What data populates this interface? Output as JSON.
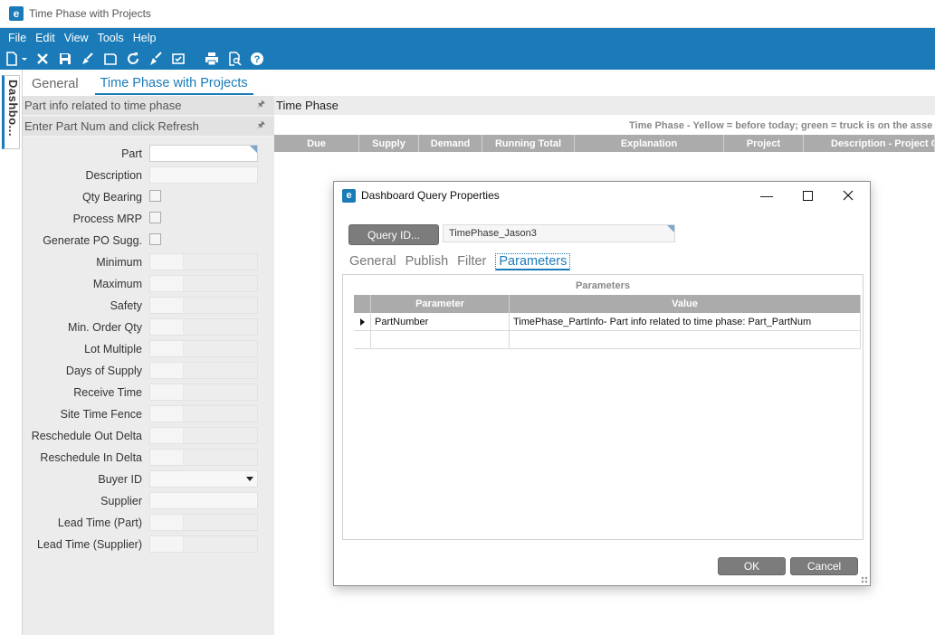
{
  "window": {
    "title": "Time Phase with Projects",
    "logo": "e"
  },
  "menu": [
    "File",
    "Edit",
    "View",
    "Tools",
    "Help"
  ],
  "toolbar_icons": [
    "new-icon",
    "dropdown-arrow-icon",
    "delete-icon",
    "save-icon",
    "clear-icon",
    "new-page-icon",
    "refresh-icon",
    "clear-broom-icon",
    "approve-icon",
    "print-icon",
    "print-preview-icon",
    "help-icon"
  ],
  "side_tab": {
    "label": "Dashbo..."
  },
  "tabs": [
    {
      "label": "General",
      "active": false
    },
    {
      "label": "Time Phase with Projects",
      "active": true
    }
  ],
  "left_panel": {
    "headers": [
      "Part info related to time phase",
      "Enter Part Num and click Refresh"
    ],
    "fields": [
      {
        "label": "Part",
        "type": "text"
      },
      {
        "label": "Description",
        "type": "text"
      },
      {
        "label": "Qty Bearing",
        "type": "checkbox"
      },
      {
        "label": "Process MRP",
        "type": "checkbox"
      },
      {
        "label": "Generate PO Sugg.",
        "type": "checkbox"
      },
      {
        "label": "Minimum",
        "type": "number"
      },
      {
        "label": "Maximum",
        "type": "number"
      },
      {
        "label": "Safety",
        "type": "number"
      },
      {
        "label": "Min. Order Qty",
        "type": "number"
      },
      {
        "label": "Lot Multiple",
        "type": "number"
      },
      {
        "label": "Days of Supply",
        "type": "number"
      },
      {
        "label": "Receive Time",
        "type": "number"
      },
      {
        "label": "Site Time Fence",
        "type": "number"
      },
      {
        "label": "Reschedule Out Delta",
        "type": "number"
      },
      {
        "label": "Reschedule In Delta",
        "type": "number"
      },
      {
        "label": "Buyer ID",
        "type": "dropdown"
      },
      {
        "label": "Supplier",
        "type": "text"
      },
      {
        "label": "Lead Time (Part)",
        "type": "number"
      },
      {
        "label": "Lead Time (Supplier)",
        "type": "number"
      }
    ]
  },
  "time_phase": {
    "title": "Time Phase",
    "caption": "Time Phase - Yellow = before today; green = truck is on the asse",
    "columns": [
      "Due",
      "Supply",
      "Demand",
      "Running Total",
      "Explanation",
      "Project",
      "Description - Project O"
    ]
  },
  "dialog": {
    "title": "Dashboard Query Properties",
    "query_button": "Query ID...",
    "query_id": "TimePhase_Jason3",
    "tabs": [
      {
        "label": "General",
        "active": false
      },
      {
        "label": "Publish",
        "active": false
      },
      {
        "label": "Filter",
        "active": false
      },
      {
        "label": "Parameters",
        "active": true
      }
    ],
    "params_caption": "Parameters",
    "param_columns": [
      "Parameter",
      "Value"
    ],
    "param_rows": [
      {
        "parameter": "PartNumber",
        "value": "TimePhase_PartInfo- Part info related to time phase: Part_PartNum"
      },
      {
        "parameter": "",
        "value": ""
      }
    ],
    "ok": "OK",
    "cancel": "Cancel"
  }
}
